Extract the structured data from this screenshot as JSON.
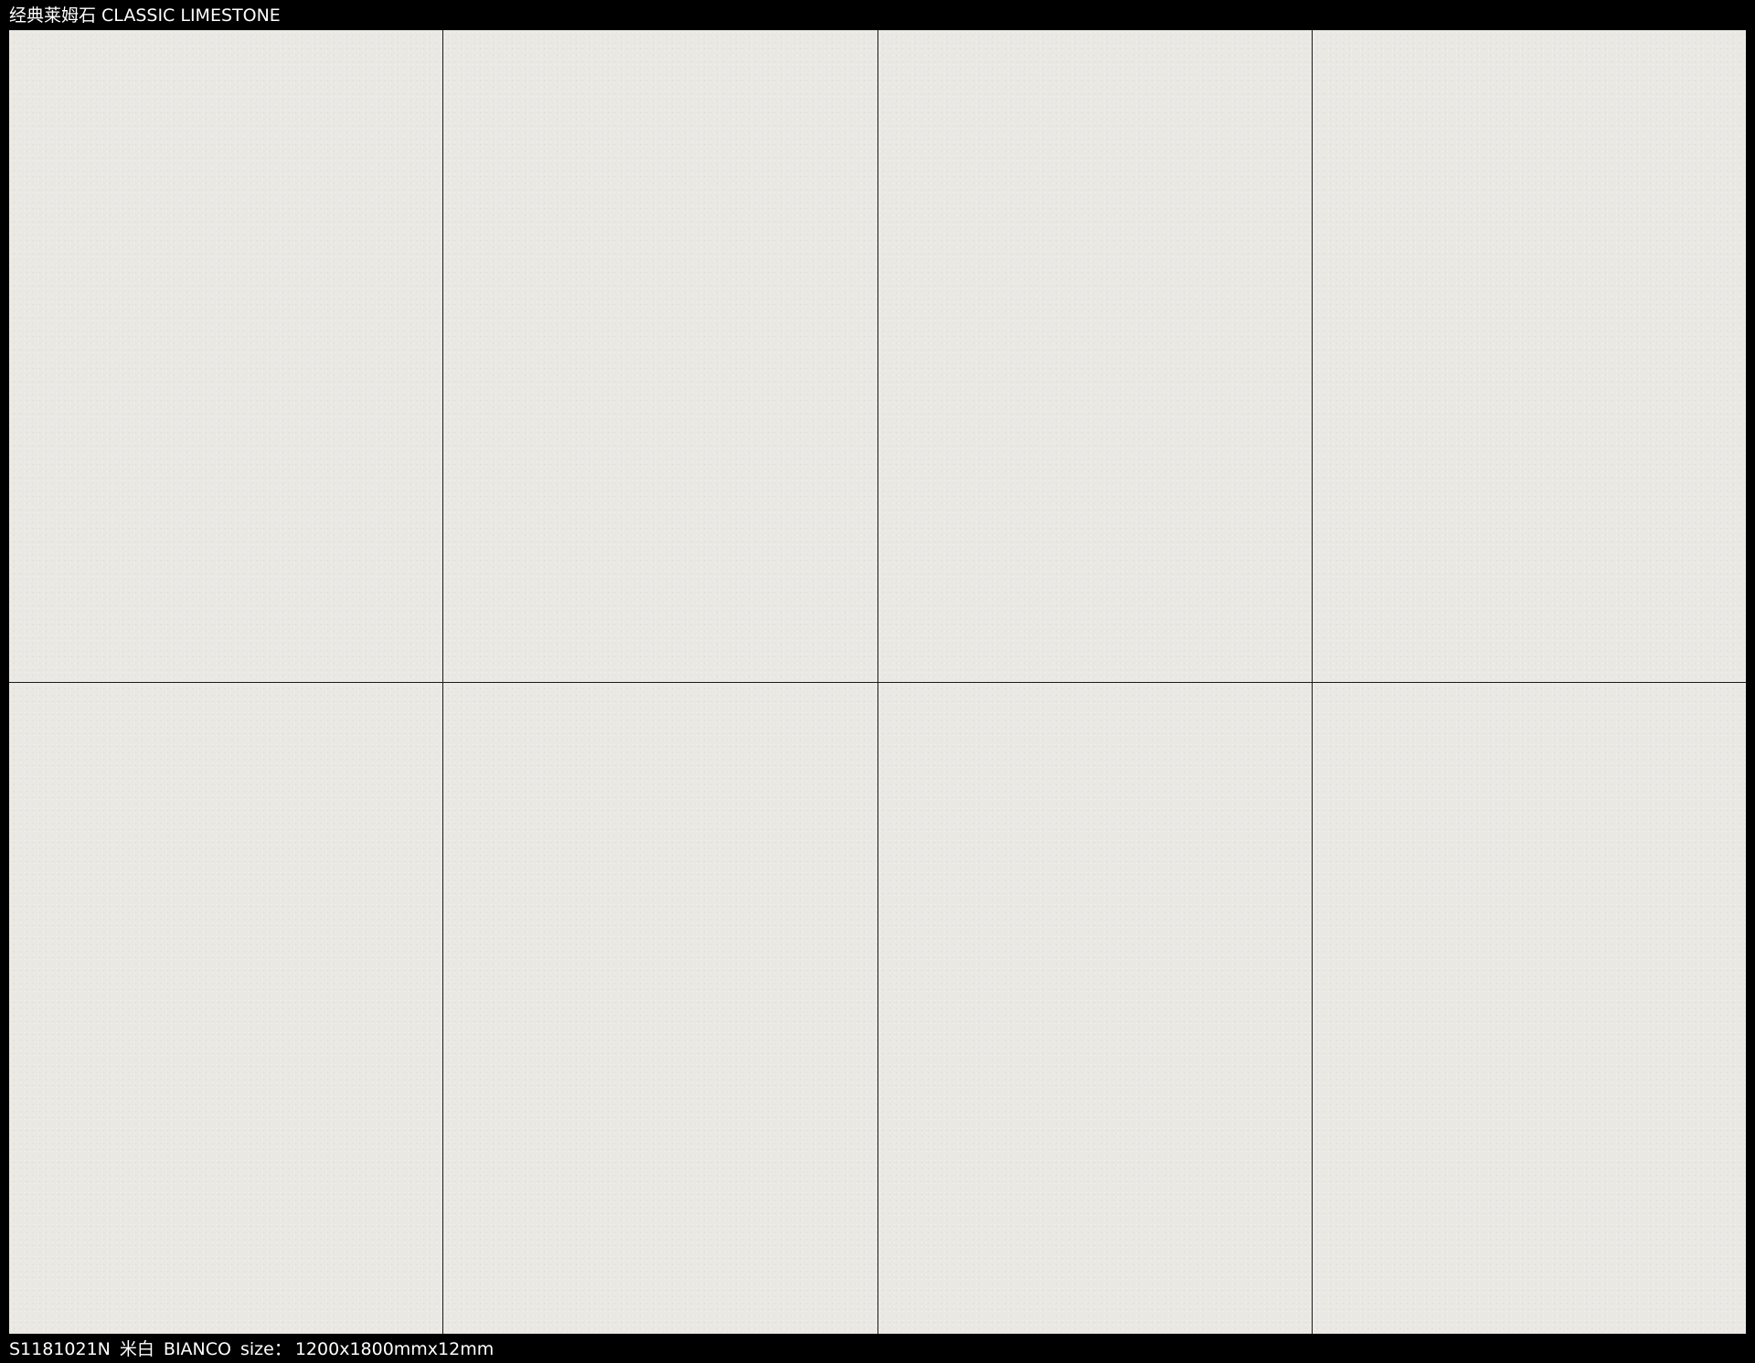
{
  "header": {
    "title": "经典莱姆石 CLASSIC LIMESTONE"
  },
  "tiles": {
    "rows": 2,
    "columns": 4,
    "surface_color": "#e9e8e3",
    "joint_color": "#1a1a1a"
  },
  "footer": {
    "code": "S1181021N",
    "color_name_cn": "米白",
    "color_name_en": "BIANCO",
    "size_label": "size：",
    "size_value": "1200x1800mmx12mm"
  }
}
